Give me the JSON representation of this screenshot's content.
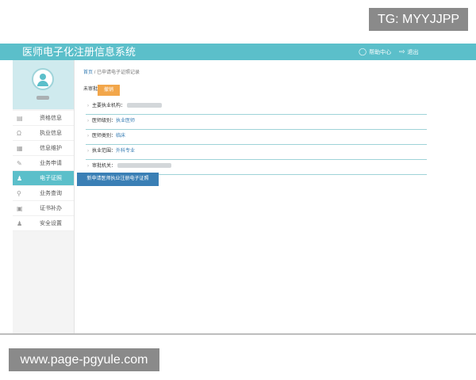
{
  "watermarks": {
    "top": "TG: MYYJJPP",
    "bottom": "www.page-pgyule.com"
  },
  "header": {
    "title": "医师电子化注册信息系统",
    "help_label": "帮助中心",
    "logout_label": "退出",
    "help_icon": "lightbulb-icon",
    "logout_icon": "logout-icon"
  },
  "sidebar": {
    "items": [
      {
        "label": "资格信息",
        "icon": "document-icon"
      },
      {
        "label": "执业信息",
        "icon": "headset-icon"
      },
      {
        "label": "信息维护",
        "icon": "id-card-icon"
      },
      {
        "label": "业务申请",
        "icon": "edit-icon"
      },
      {
        "label": "电子证照",
        "icon": "user-icon",
        "active": true
      },
      {
        "label": "业务查询",
        "icon": "search-icon"
      },
      {
        "label": "证书补办",
        "icon": "save-icon"
      },
      {
        "label": "安全设置",
        "icon": "user-lock-icon"
      }
    ]
  },
  "breadcrumb": {
    "home": "首页",
    "sep": "/",
    "current": "已申请电子证照记录"
  },
  "status": {
    "label": "未审批",
    "withdraw_label": "撤销"
  },
  "record": {
    "org_label": "主要执业机构：",
    "level_label": "医师级别：",
    "level_value": "执业医师",
    "type_label": "医师类别：",
    "type_value": "临床",
    "scope_label": "执业范围：",
    "scope_value": "外科专业",
    "authority_label": "审批机关："
  },
  "new_apply_label": "新申请医师执业注册电子证照",
  "colors": {
    "accent": "#5bbfca",
    "primary": "#3a7fb5",
    "warning": "#f2a64a"
  }
}
